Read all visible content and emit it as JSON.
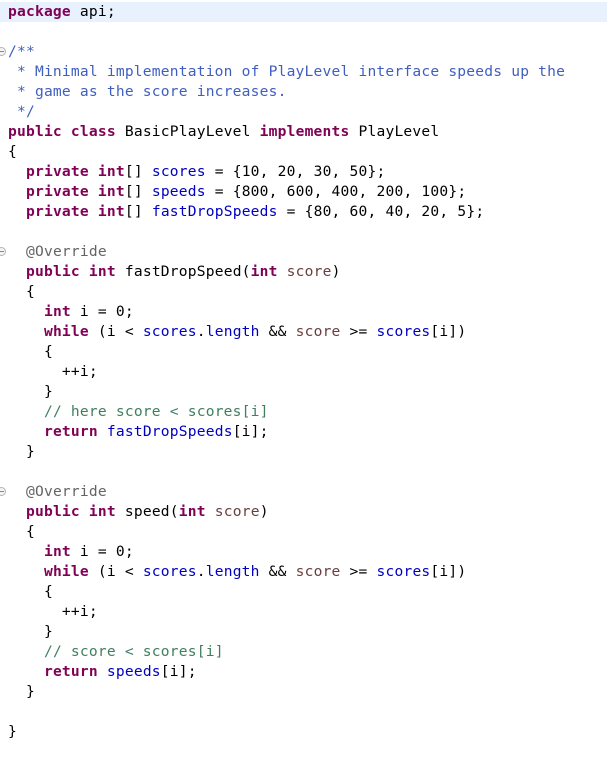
{
  "editor": {
    "language": "java",
    "current_line": 1,
    "colors": {
      "keyword": "#7F0055",
      "field": "#0000C0",
      "parameter": "#6A3E3E",
      "javadoc": "#3F5FBF",
      "comment": "#3F7F5F",
      "annotation": "#646464",
      "current_line_highlight": "#E8F2FE"
    },
    "lines": [
      {
        "fold": false,
        "tokens": [
          [
            "kw",
            "package"
          ],
          [
            "plain",
            " api;"
          ]
        ]
      },
      {
        "fold": false,
        "tokens": []
      },
      {
        "fold": true,
        "tokens": [
          [
            "jdoc",
            "/**"
          ]
        ]
      },
      {
        "fold": false,
        "tokens": [
          [
            "jdoc",
            " * Minimal implementation of PlayLevel interface speeds up the"
          ]
        ]
      },
      {
        "fold": false,
        "tokens": [
          [
            "jdoc",
            " * game as the score increases."
          ]
        ]
      },
      {
        "fold": false,
        "tokens": [
          [
            "jdoc",
            " */"
          ]
        ]
      },
      {
        "fold": false,
        "tokens": [
          [
            "kw",
            "public"
          ],
          [
            "plain",
            " "
          ],
          [
            "kw",
            "class"
          ],
          [
            "plain",
            " BasicPlayLevel "
          ],
          [
            "kw",
            "implements"
          ],
          [
            "plain",
            " PlayLevel"
          ]
        ]
      },
      {
        "fold": false,
        "tokens": [
          [
            "plain",
            "{"
          ]
        ]
      },
      {
        "fold": false,
        "tokens": [
          [
            "plain",
            "  "
          ],
          [
            "kw",
            "private"
          ],
          [
            "plain",
            " "
          ],
          [
            "kw",
            "int"
          ],
          [
            "plain",
            "[] "
          ],
          [
            "field",
            "scores"
          ],
          [
            "plain",
            " = {10, 20, 30, 50};"
          ]
        ]
      },
      {
        "fold": false,
        "tokens": [
          [
            "plain",
            "  "
          ],
          [
            "kw",
            "private"
          ],
          [
            "plain",
            " "
          ],
          [
            "kw",
            "int"
          ],
          [
            "plain",
            "[] "
          ],
          [
            "field",
            "speeds"
          ],
          [
            "plain",
            " = {800, 600, 400, 200, 100};"
          ]
        ]
      },
      {
        "fold": false,
        "tokens": [
          [
            "plain",
            "  "
          ],
          [
            "kw",
            "private"
          ],
          [
            "plain",
            " "
          ],
          [
            "kw",
            "int"
          ],
          [
            "plain",
            "[] "
          ],
          [
            "field",
            "fastDropSpeeds"
          ],
          [
            "plain",
            " = {80, 60, 40, 20, 5};"
          ]
        ]
      },
      {
        "fold": false,
        "tokens": []
      },
      {
        "fold": true,
        "tokens": [
          [
            "plain",
            "  "
          ],
          [
            "ann",
            "@Override"
          ]
        ]
      },
      {
        "fold": false,
        "tokens": [
          [
            "plain",
            "  "
          ],
          [
            "kw",
            "public"
          ],
          [
            "plain",
            " "
          ],
          [
            "kw",
            "int"
          ],
          [
            "plain",
            " fastDropSpeed("
          ],
          [
            "kw",
            "int"
          ],
          [
            "plain",
            " "
          ],
          [
            "param",
            "score"
          ],
          [
            "plain",
            ")"
          ]
        ]
      },
      {
        "fold": false,
        "tokens": [
          [
            "plain",
            "  {"
          ]
        ]
      },
      {
        "fold": false,
        "tokens": [
          [
            "plain",
            "    "
          ],
          [
            "kw",
            "int"
          ],
          [
            "plain",
            " i = 0;"
          ]
        ]
      },
      {
        "fold": false,
        "tokens": [
          [
            "plain",
            "    "
          ],
          [
            "kw",
            "while"
          ],
          [
            "plain",
            " (i < "
          ],
          [
            "field",
            "scores"
          ],
          [
            "plain",
            "."
          ],
          [
            "field",
            "length"
          ],
          [
            "plain",
            " && "
          ],
          [
            "param",
            "score"
          ],
          [
            "plain",
            " >= "
          ],
          [
            "field",
            "scores"
          ],
          [
            "plain",
            "[i])"
          ]
        ]
      },
      {
        "fold": false,
        "tokens": [
          [
            "plain",
            "    {"
          ]
        ]
      },
      {
        "fold": false,
        "tokens": [
          [
            "plain",
            "      ++i;"
          ]
        ]
      },
      {
        "fold": false,
        "tokens": [
          [
            "plain",
            "    }"
          ]
        ]
      },
      {
        "fold": false,
        "tokens": [
          [
            "plain",
            "    "
          ],
          [
            "cmt",
            "// here score < scores[i]"
          ]
        ]
      },
      {
        "fold": false,
        "tokens": [
          [
            "plain",
            "    "
          ],
          [
            "kw",
            "return"
          ],
          [
            "plain",
            " "
          ],
          [
            "field",
            "fastDropSpeeds"
          ],
          [
            "plain",
            "[i];"
          ]
        ]
      },
      {
        "fold": false,
        "tokens": [
          [
            "plain",
            "  }"
          ]
        ]
      },
      {
        "fold": false,
        "tokens": []
      },
      {
        "fold": true,
        "tokens": [
          [
            "plain",
            "  "
          ],
          [
            "ann",
            "@Override"
          ]
        ]
      },
      {
        "fold": false,
        "tokens": [
          [
            "plain",
            "  "
          ],
          [
            "kw",
            "public"
          ],
          [
            "plain",
            " "
          ],
          [
            "kw",
            "int"
          ],
          [
            "plain",
            " speed("
          ],
          [
            "kw",
            "int"
          ],
          [
            "plain",
            " "
          ],
          [
            "param",
            "score"
          ],
          [
            "plain",
            ")"
          ]
        ]
      },
      {
        "fold": false,
        "tokens": [
          [
            "plain",
            "  {"
          ]
        ]
      },
      {
        "fold": false,
        "tokens": [
          [
            "plain",
            "    "
          ],
          [
            "kw",
            "int"
          ],
          [
            "plain",
            " i = 0;"
          ]
        ]
      },
      {
        "fold": false,
        "tokens": [
          [
            "plain",
            "    "
          ],
          [
            "kw",
            "while"
          ],
          [
            "plain",
            " (i < "
          ],
          [
            "field",
            "scores"
          ],
          [
            "plain",
            "."
          ],
          [
            "field",
            "length"
          ],
          [
            "plain",
            " && "
          ],
          [
            "param",
            "score"
          ],
          [
            "plain",
            " >= "
          ],
          [
            "field",
            "scores"
          ],
          [
            "plain",
            "[i])"
          ]
        ]
      },
      {
        "fold": false,
        "tokens": [
          [
            "plain",
            "    {"
          ]
        ]
      },
      {
        "fold": false,
        "tokens": [
          [
            "plain",
            "      ++i;"
          ]
        ]
      },
      {
        "fold": false,
        "tokens": [
          [
            "plain",
            "    }"
          ]
        ]
      },
      {
        "fold": false,
        "tokens": [
          [
            "plain",
            "    "
          ],
          [
            "cmt",
            "// score < scores[i]"
          ]
        ]
      },
      {
        "fold": false,
        "tokens": [
          [
            "plain",
            "    "
          ],
          [
            "kw",
            "return"
          ],
          [
            "plain",
            " "
          ],
          [
            "field",
            "speeds"
          ],
          [
            "plain",
            "[i];"
          ]
        ]
      },
      {
        "fold": false,
        "tokens": [
          [
            "plain",
            "  }"
          ]
        ]
      },
      {
        "fold": false,
        "tokens": []
      },
      {
        "fold": false,
        "tokens": [
          [
            "plain",
            "}"
          ]
        ]
      }
    ]
  }
}
